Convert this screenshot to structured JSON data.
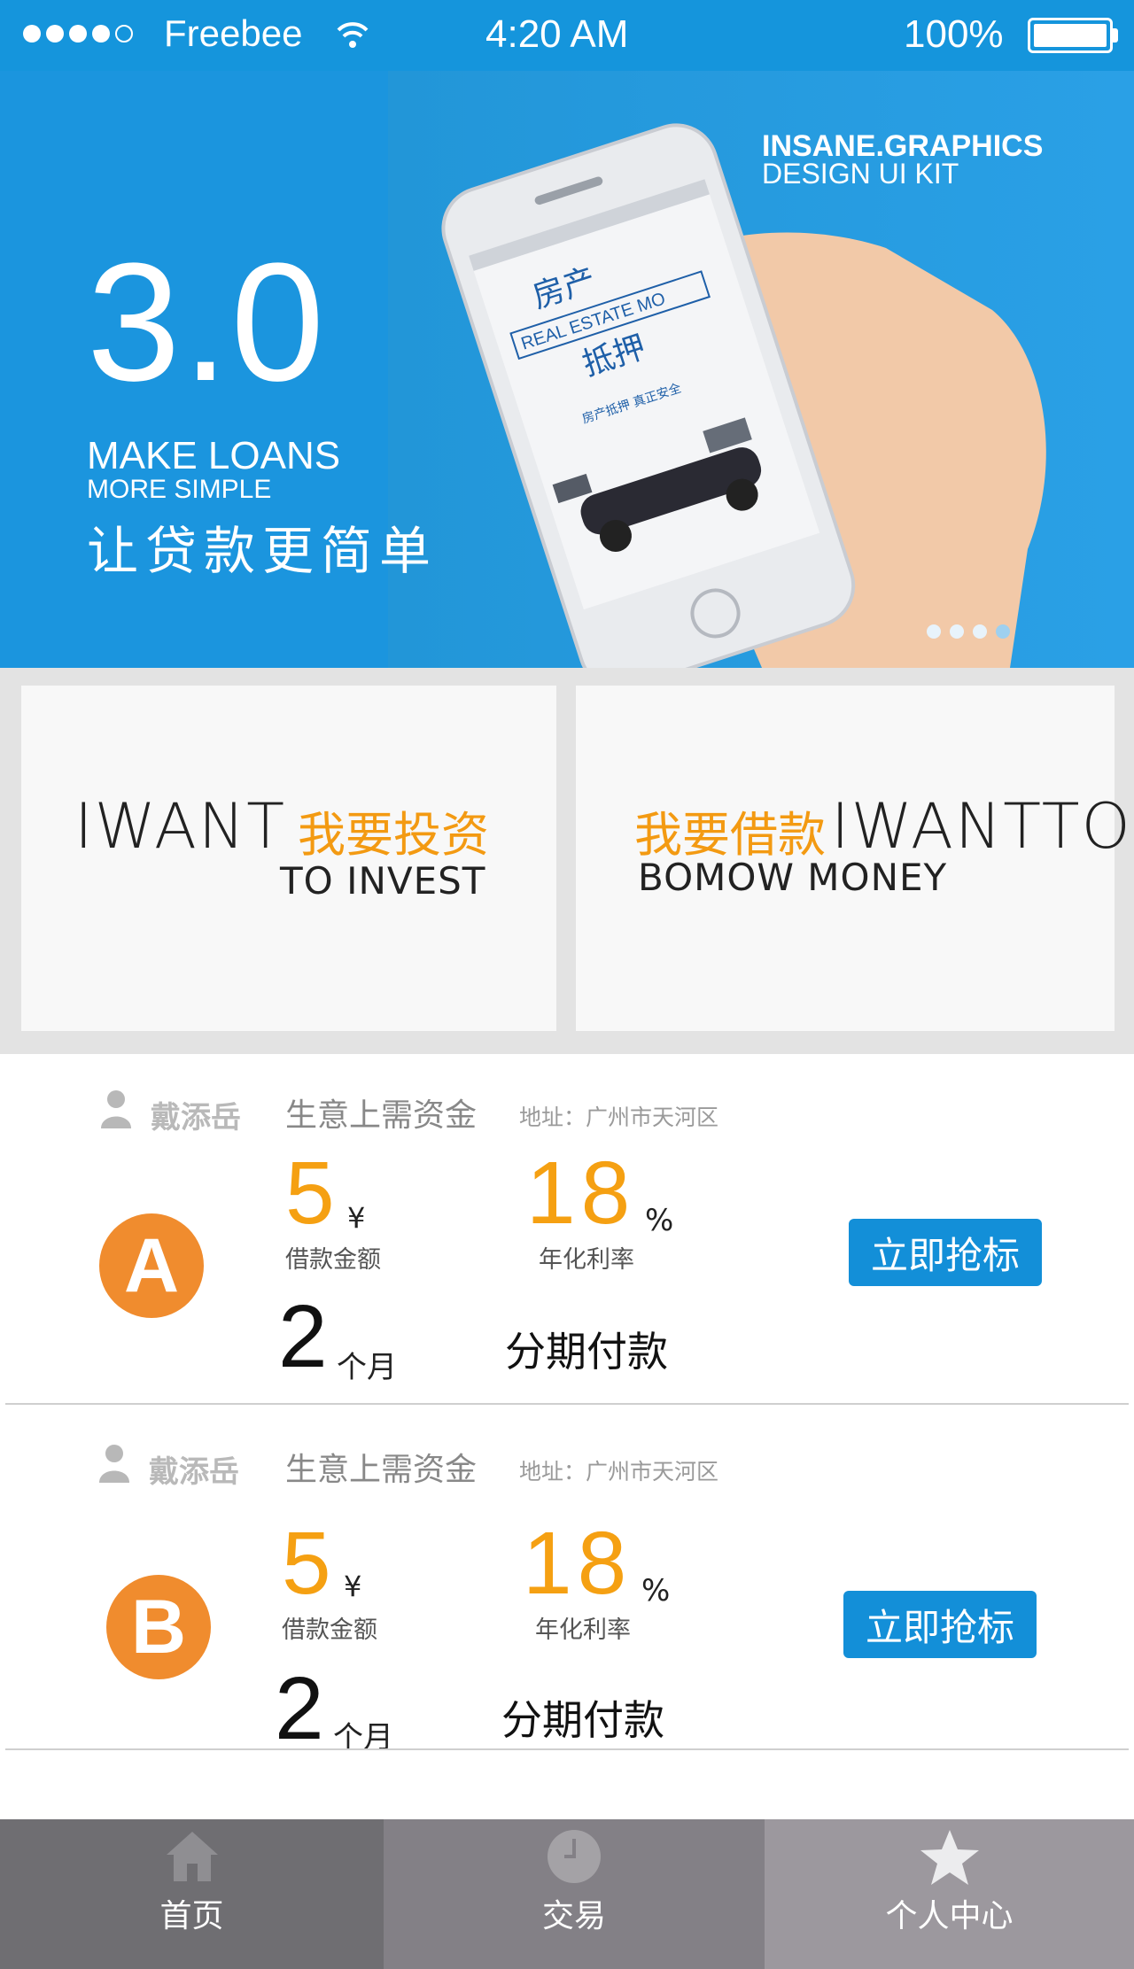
{
  "status_bar": {
    "carrier": "Freebee",
    "time": "4:20 AM",
    "battery": "100%",
    "signal_dots_filled": 4
  },
  "banner": {
    "version": "3.0",
    "headline": "MAKE LOANS",
    "subline": "MORE SIMPLE",
    "slogan_cn": "让贷款更简单",
    "kit_title": "INSANE.GRAPHICS",
    "kit_subtitle": "DESIGN UI KIT",
    "pages": 4,
    "active_page": 1
  },
  "promo": {
    "invest": {
      "en_main": "IWANT",
      "cn": "我要投资",
      "en_sub": "TO INVEST"
    },
    "borrow": {
      "cn": "我要借款",
      "en_main": "IWANTTO",
      "en_sub": "BOMOW MONEY"
    }
  },
  "loans": [
    {
      "badge": "A",
      "user": "戴添岳",
      "purpose": "生意上需资金",
      "address": "地址：广州市天河区",
      "amount": "5",
      "amount_unit": "¥",
      "amount_label": "借款金额",
      "rate": "18",
      "rate_unit": "%",
      "rate_label": "年化利率",
      "term": "2",
      "term_unit": "个月",
      "repayment": "分期付款",
      "action": "立即抢标"
    },
    {
      "badge": "B",
      "user": "戴添岳",
      "purpose": "生意上需资金",
      "address": "地址：广州市天河区",
      "amount": "5",
      "amount_unit": "¥",
      "amount_label": "借款金额",
      "rate": "18",
      "rate_unit": "%",
      "rate_label": "年化利率",
      "term": "2",
      "term_unit": "个月",
      "repayment": "分期付款",
      "action": "立即抢标"
    }
  ],
  "tabs": [
    {
      "label": "首页",
      "icon": "home-icon",
      "bg": "#6f6e72"
    },
    {
      "label": "交易",
      "icon": "clock-icon",
      "bg": "#838086"
    },
    {
      "label": "个人中心",
      "icon": "star-icon",
      "bg": "#9c989e"
    }
  ],
  "colors": {
    "brand_blue": "#1595dc",
    "accent_orange": "#f5a012",
    "button_blue": "#138fd8",
    "badge_orange": "#f08c2e"
  }
}
